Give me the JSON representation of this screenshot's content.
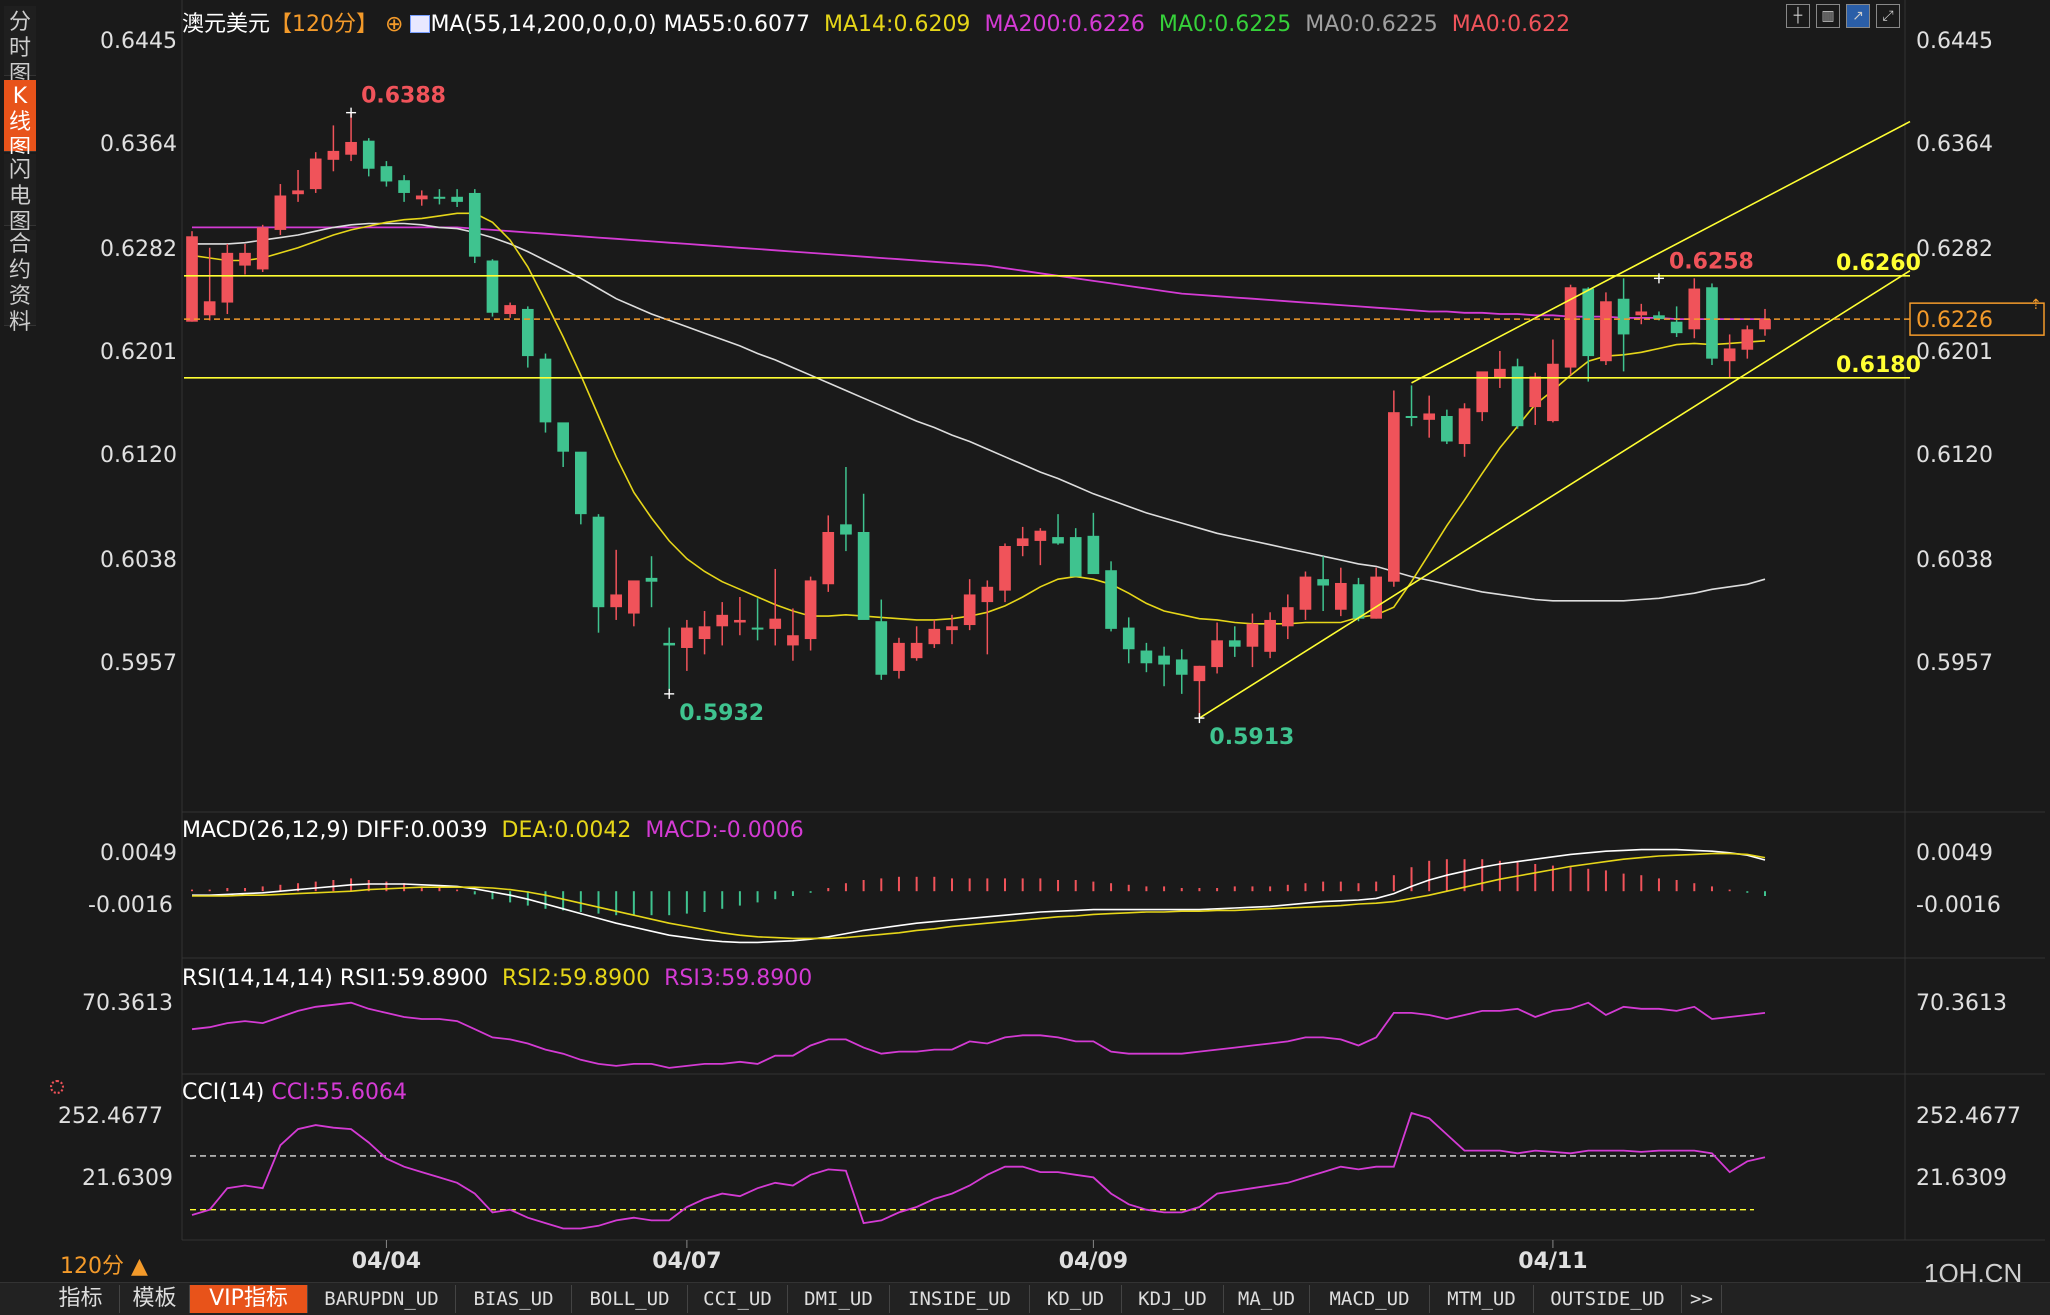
{
  "side_tabs": [
    "分\n时\n图",
    "K\n线\n图",
    "闪\n电\n图",
    "合\n约\n资\n料"
  ],
  "header": {
    "symbol": "澳元美元",
    "period": "【120分】",
    "ma_params": "MA(55,14,200,0,0,0)",
    "ma55": "MA55:0.6077",
    "ma14": "MA14:0.6209",
    "ma200": "MA200:0.6226",
    "ma0_a": "MA0:0.6225",
    "ma0_b": "MA0:0.6225",
    "ma0_c": "MA0:0.622"
  },
  "macd_header": {
    "name": "MACD(26,12,9)",
    "diff": "DIFF:0.0039",
    "dea": "DEA:0.0042",
    "macd": "MACD:-0.0006"
  },
  "rsi_header": {
    "name": "RSI(14,14,14)",
    "rsi1": "RSI1:59.8900",
    "rsi2": "RSI2:59.8900",
    "rsi3": "RSI3:59.8900"
  },
  "cci_header": {
    "name": "CCI(14)",
    "cci": "CCI:55.6064"
  },
  "period_button": "120分",
  "watermark": "1QH.CN",
  "bottom_tabs": [
    "指标",
    "模板",
    "VIP指标",
    "BARUPDN_UD",
    "BIAS_UD",
    "BOLL_UD",
    "CCI_UD",
    "DMI_UD",
    "INSIDE_UD",
    "KD_UD",
    "KDJ_UD",
    "MA_UD",
    "MACD_UD",
    "MTM_UD",
    "OUTSIDE_UD",
    ">>"
  ],
  "colors": {
    "up": "#f0535a",
    "down": "#3fc38f",
    "ma14": "#e6d619",
    "ma55": "#dddddd",
    "ma200": "#d43bd4",
    "trend": "#ffff33",
    "price_tag": "#f39a2a"
  },
  "chart_data": {
    "type": "candlestick",
    "y_ticks": [
      "0.6445",
      "0.6364",
      "0.6282",
      "0.6201",
      "0.6120",
      "0.6038",
      "0.5957"
    ],
    "y_range": [
      0.589,
      0.6465
    ],
    "x_labels": [
      "04/04",
      "04/07",
      "04/09",
      "04/11"
    ],
    "x_label_index": [
      11,
      28,
      51,
      77
    ],
    "ohlc": [
      [
        0.6224,
        0.6295,
        0.6224,
        0.6291
      ],
      [
        0.6229,
        0.6282,
        0.6225,
        0.624
      ],
      [
        0.6239,
        0.6285,
        0.623,
        0.6278
      ],
      [
        0.6268,
        0.6285,
        0.6261,
        0.6278
      ],
      [
        0.6265,
        0.63,
        0.6263,
        0.6298
      ],
      [
        0.6296,
        0.6332,
        0.6292,
        0.6323
      ],
      [
        0.6324,
        0.6343,
        0.6318,
        0.6327
      ],
      [
        0.6328,
        0.6357,
        0.6325,
        0.6352
      ],
      [
        0.6351,
        0.6378,
        0.6342,
        0.6358
      ],
      [
        0.6355,
        0.6388,
        0.635,
        0.6365
      ],
      [
        0.6366,
        0.6368,
        0.6338,
        0.6344
      ],
      [
        0.6346,
        0.635,
        0.633,
        0.6334
      ],
      [
        0.6335,
        0.6339,
        0.6318,
        0.6325
      ],
      [
        0.632,
        0.6327,
        0.6315,
        0.6323
      ],
      [
        0.6322,
        0.6328,
        0.6316,
        0.6321
      ],
      [
        0.6322,
        0.6328,
        0.6314,
        0.6318
      ],
      [
        0.6325,
        0.6328,
        0.627,
        0.6275
      ],
      [
        0.6272,
        0.6273,
        0.6228,
        0.6231
      ],
      [
        0.623,
        0.6239,
        0.6227,
        0.6237
      ],
      [
        0.6234,
        0.6236,
        0.6188,
        0.6197
      ],
      [
        0.6195,
        0.6199,
        0.6137,
        0.6145
      ],
      [
        0.6145,
        0.6144,
        0.611,
        0.6122
      ],
      [
        0.6122,
        0.6118,
        0.6065,
        0.6073
      ],
      [
        0.6071,
        0.6073,
        0.598,
        0.6
      ],
      [
        0.6,
        0.6045,
        0.599,
        0.601
      ],
      [
        0.5995,
        0.6018,
        0.5985,
        0.6021
      ],
      [
        0.6023,
        0.604,
        0.6,
        0.602
      ],
      [
        0.5972,
        0.5984,
        0.5934,
        0.597
      ],
      [
        0.5968,
        0.599,
        0.595,
        0.5984
      ],
      [
        0.5975,
        0.5997,
        0.5963,
        0.5985
      ],
      [
        0.5985,
        0.6004,
        0.597,
        0.5994
      ],
      [
        0.5988,
        0.6008,
        0.5978,
        0.599
      ],
      [
        0.5984,
        0.6007,
        0.5974,
        0.5983
      ],
      [
        0.5983,
        0.603,
        0.597,
        0.5991
      ],
      [
        0.597,
        0.5999,
        0.5958,
        0.5978
      ],
      [
        0.5975,
        0.6024,
        0.5966,
        0.6021
      ],
      [
        0.6018,
        0.6072,
        0.6012,
        0.6059
      ],
      [
        0.6065,
        0.611,
        0.6044,
        0.6057
      ],
      [
        0.6059,
        0.6089,
        0.604,
        0.599
      ],
      [
        0.5989,
        0.6006,
        0.5943,
        0.5947
      ],
      [
        0.595,
        0.5976,
        0.5944,
        0.5972
      ],
      [
        0.596,
        0.5985,
        0.5958,
        0.5972
      ],
      [
        0.5971,
        0.599,
        0.5968,
        0.5983
      ],
      [
        0.5982,
        0.5994,
        0.5971,
        0.5985
      ],
      [
        0.5986,
        0.6022,
        0.5982,
        0.601
      ],
      [
        0.6004,
        0.6021,
        0.5963,
        0.6016
      ],
      [
        0.6013,
        0.605,
        0.6004,
        0.6048
      ],
      [
        0.6048,
        0.6063,
        0.604,
        0.6054
      ],
      [
        0.6052,
        0.6062,
        0.6033,
        0.606
      ],
      [
        0.6055,
        0.6073,
        0.6049,
        0.605
      ],
      [
        0.6055,
        0.6062,
        0.6052,
        0.6024
      ],
      [
        0.6056,
        0.6074,
        0.6046,
        0.6026
      ],
      [
        0.6029,
        0.6036,
        0.5981,
        0.5983
      ],
      [
        0.5984,
        0.5992,
        0.5956,
        0.5967
      ],
      [
        0.5966,
        0.5972,
        0.5949,
        0.5956
      ],
      [
        0.5962,
        0.5969,
        0.5938,
        0.5955
      ],
      [
        0.5959,
        0.5967,
        0.5932,
        0.5947
      ],
      [
        0.5942,
        0.5954,
        0.5913,
        0.5954
      ],
      [
        0.5953,
        0.5988,
        0.5948,
        0.5974
      ],
      [
        0.5974,
        0.5985,
        0.5961,
        0.5969
      ],
      [
        0.5969,
        0.5995,
        0.5953,
        0.5987
      ],
      [
        0.5965,
        0.5996,
        0.596,
        0.599
      ],
      [
        0.5985,
        0.601,
        0.5975,
        0.6
      ],
      [
        0.5998,
        0.6028,
        0.599,
        0.6024
      ],
      [
        0.6022,
        0.604,
        0.5997,
        0.6017
      ],
      [
        0.5998,
        0.6031,
        0.5993,
        0.6019
      ],
      [
        0.6018,
        0.6023,
        0.5989,
        0.5991
      ],
      [
        0.5991,
        0.6031,
        0.5991,
        0.6024
      ],
      [
        0.602,
        0.617,
        0.6016,
        0.6153
      ],
      [
        0.615,
        0.6174,
        0.6142,
        0.6149
      ],
      [
        0.6147,
        0.6166,
        0.6133,
        0.6152
      ],
      [
        0.615,
        0.6155,
        0.6128,
        0.613
      ],
      [
        0.6128,
        0.616,
        0.6118,
        0.6156
      ],
      [
        0.6153,
        0.6184,
        0.6146,
        0.6185
      ],
      [
        0.618,
        0.6201,
        0.6172,
        0.6187
      ],
      [
        0.6189,
        0.6195,
        0.614,
        0.6142
      ],
      [
        0.6157,
        0.6184,
        0.6143,
        0.6181
      ],
      [
        0.6146,
        0.621,
        0.6145,
        0.6191
      ],
      [
        0.6188,
        0.6253,
        0.6182,
        0.6251
      ],
      [
        0.625,
        0.6251,
        0.6177,
        0.6197
      ],
      [
        0.6193,
        0.6247,
        0.619,
        0.624
      ],
      [
        0.6242,
        0.6258,
        0.6185,
        0.6214
      ],
      [
        0.6229,
        0.6238,
        0.6222,
        0.6232
      ],
      [
        0.6229,
        0.6232,
        0.6225,
        0.6226
      ],
      [
        0.6224,
        0.6236,
        0.6212,
        0.6215
      ],
      [
        0.6218,
        0.6258,
        0.6211,
        0.625
      ],
      [
        0.6251,
        0.6254,
        0.619,
        0.6195
      ],
      [
        0.6193,
        0.6214,
        0.618,
        0.6203
      ],
      [
        0.6202,
        0.6221,
        0.6195,
        0.6218
      ],
      [
        0.6218,
        0.6234,
        0.6213,
        0.6226
      ]
    ],
    "ma55": [
      0.6285,
      0.6285,
      0.6285,
      0.6286,
      0.6288,
      0.629,
      0.6292,
      0.6295,
      0.6298,
      0.63,
      0.6301,
      0.6301,
      0.6301,
      0.63,
      0.6298,
      0.6297,
      0.6294,
      0.629,
      0.6285,
      0.6279,
      0.6272,
      0.6265,
      0.6258,
      0.625,
      0.6242,
      0.6236,
      0.623,
      0.6225,
      0.622,
      0.6215,
      0.621,
      0.6205,
      0.6199,
      0.6194,
      0.6188,
      0.6182,
      0.6176,
      0.617,
      0.6164,
      0.6158,
      0.6152,
      0.6146,
      0.6141,
      0.6135,
      0.613,
      0.6124,
      0.6118,
      0.6112,
      0.6106,
      0.6101,
      0.6095,
      0.6089,
      0.6084,
      0.6079,
      0.6074,
      0.607,
      0.6066,
      0.6062,
      0.6058,
      0.6055,
      0.6052,
      0.6049,
      0.6046,
      0.6043,
      0.604,
      0.6037,
      0.6034,
      0.6032,
      0.6028,
      0.6024,
      0.6021,
      0.6018,
      0.6015,
      0.6012,
      0.601,
      0.6008,
      0.6006,
      0.6005,
      0.6005,
      0.6005,
      0.6005,
      0.6005,
      0.6006,
      0.6007,
      0.6009,
      0.6011,
      0.6014,
      0.6016,
      0.6018,
      0.6022
    ],
    "ma14": [
      0.6276,
      0.6274,
      0.6272,
      0.6272,
      0.6274,
      0.6278,
      0.6282,
      0.6287,
      0.6292,
      0.6296,
      0.6299,
      0.6302,
      0.6304,
      0.6305,
      0.6307,
      0.6309,
      0.6309,
      0.6302,
      0.6288,
      0.6267,
      0.624,
      0.6212,
      0.6182,
      0.615,
      0.6118,
      0.609,
      0.607,
      0.6052,
      0.6038,
      0.6028,
      0.602,
      0.6014,
      0.6008,
      0.6002,
      0.5997,
      0.5993,
      0.5993,
      0.5994,
      0.5993,
      0.5992,
      0.5991,
      0.599,
      0.599,
      0.5991,
      0.5993,
      0.5996,
      0.6001,
      0.6008,
      0.6016,
      0.6022,
      0.6024,
      0.6022,
      0.6018,
      0.6011,
      0.6003,
      0.5997,
      0.5994,
      0.5991,
      0.599,
      0.5988,
      0.5987,
      0.5987,
      0.5987,
      0.5988,
      0.5988,
      0.5988,
      0.5992,
      0.5994,
      0.6,
      0.602,
      0.6042,
      0.6064,
      0.6084,
      0.6105,
      0.6125,
      0.6142,
      0.6159,
      0.617,
      0.6182,
      0.6193,
      0.6197,
      0.6198,
      0.62,
      0.6203,
      0.6206,
      0.6207,
      0.6206,
      0.6207,
      0.6208,
      0.6209
    ],
    "ma200": [
      0.6298,
      0.6298,
      0.6298,
      0.6298,
      0.6298,
      0.6298,
      0.6298,
      0.6298,
      0.6298,
      0.6298,
      0.6298,
      0.6298,
      0.6298,
      0.6298,
      0.6298,
      0.6298,
      0.6297,
      0.6296,
      0.6295,
      0.6294,
      0.6293,
      0.6292,
      0.6291,
      0.629,
      0.6289,
      0.6288,
      0.6287,
      0.6286,
      0.6285,
      0.6284,
      0.6283,
      0.6282,
      0.6281,
      0.628,
      0.6279,
      0.6278,
      0.6277,
      0.6276,
      0.6275,
      0.6274,
      0.6273,
      0.6272,
      0.6271,
      0.627,
      0.6269,
      0.6268,
      0.6266,
      0.6264,
      0.6262,
      0.626,
      0.6258,
      0.6256,
      0.6254,
      0.6252,
      0.625,
      0.6248,
      0.6246,
      0.6245,
      0.6244,
      0.6243,
      0.6242,
      0.6241,
      0.624,
      0.6239,
      0.6238,
      0.6237,
      0.6236,
      0.6235,
      0.6234,
      0.6233,
      0.6232,
      0.6232,
      0.6231,
      0.6231,
      0.623,
      0.623,
      0.6229,
      0.6229,
      0.6228,
      0.6228,
      0.6228,
      0.6227,
      0.6227,
      0.6227,
      0.6226,
      0.6226,
      0.6226,
      0.6226,
      0.6226,
      0.6226
    ],
    "annotations": [
      {
        "label": "0.6388",
        "price": 0.6388,
        "index": 9,
        "color": "#f0535a"
      },
      {
        "label": "0.5932",
        "price": 0.5932,
        "index": 27,
        "color": "#3fc38f"
      },
      {
        "label": "0.5913",
        "price": 0.5913,
        "index": 57,
        "color": "#3fc38f"
      },
      {
        "label": "0.6258",
        "price": 0.6258,
        "index": 83,
        "color": "#f0535a"
      }
    ],
    "horizontal_lines": [
      {
        "price": 0.626,
        "label": "0.6260"
      },
      {
        "price": 0.618,
        "label": "0.6180"
      }
    ],
    "last_price": {
      "price": 0.6226,
      "label": "0.6226"
    },
    "macd": {
      "y_ticks": [
        "0.0049",
        "-0.0016"
      ],
      "diff": [
        -0.0005,
        -0.0005,
        -0.0004,
        -0.0003,
        -0.0002,
        0.0,
        0.0002,
        0.0004,
        0.0006,
        0.0008,
        0.0009,
        0.0009,
        0.0009,
        0.0008,
        0.0007,
        0.0006,
        0.0003,
        -0.0001,
        -0.0005,
        -0.001,
        -0.0016,
        -0.0022,
        -0.0028,
        -0.0034,
        -0.004,
        -0.0045,
        -0.005,
        -0.0055,
        -0.0058,
        -0.0061,
        -0.0063,
        -0.0064,
        -0.0064,
        -0.0063,
        -0.0062,
        -0.006,
        -0.0057,
        -0.0053,
        -0.0049,
        -0.0046,
        -0.0043,
        -0.004,
        -0.0038,
        -0.0036,
        -0.0034,
        -0.0032,
        -0.003,
        -0.0028,
        -0.0026,
        -0.0025,
        -0.0024,
        -0.0023,
        -0.0023,
        -0.0023,
        -0.0023,
        -0.0023,
        -0.0023,
        -0.0023,
        -0.0022,
        -0.0021,
        -0.002,
        -0.0019,
        -0.0017,
        -0.0015,
        -0.0013,
        -0.0012,
        -0.0011,
        -0.0009,
        -0.0003,
        0.0006,
        0.0014,
        0.002,
        0.0025,
        0.003,
        0.0034,
        0.0037,
        0.004,
        0.0043,
        0.0046,
        0.0048,
        0.005,
        0.0051,
        0.0052,
        0.0052,
        0.0052,
        0.0051,
        0.005,
        0.0048,
        0.0045,
        0.0039
      ],
      "dea": [
        -0.0006,
        -0.0006,
        -0.0006,
        -0.0005,
        -0.0005,
        -0.0004,
        -0.0003,
        -0.0002,
        -0.0001,
        0.0,
        0.0002,
        0.0003,
        0.0004,
        0.0005,
        0.0005,
        0.0005,
        0.0005,
        0.0004,
        0.0002,
        -0.0001,
        -0.0005,
        -0.001,
        -0.0015,
        -0.002,
        -0.0025,
        -0.003,
        -0.0035,
        -0.004,
        -0.0044,
        -0.0048,
        -0.0052,
        -0.0055,
        -0.0057,
        -0.0058,
        -0.0059,
        -0.0059,
        -0.0059,
        -0.0058,
        -0.0056,
        -0.0054,
        -0.0052,
        -0.0049,
        -0.0047,
        -0.0044,
        -0.0042,
        -0.004,
        -0.0038,
        -0.0036,
        -0.0034,
        -0.0032,
        -0.0031,
        -0.0029,
        -0.0028,
        -0.0027,
        -0.0026,
        -0.0026,
        -0.0025,
        -0.0025,
        -0.0024,
        -0.0024,
        -0.0023,
        -0.0022,
        -0.0021,
        -0.002,
        -0.0019,
        -0.0018,
        -0.0016,
        -0.0015,
        -0.0013,
        -0.0009,
        -0.0005,
        0.0,
        0.0005,
        0.001,
        0.0015,
        0.0019,
        0.0023,
        0.0027,
        0.0031,
        0.0034,
        0.0037,
        0.004,
        0.0042,
        0.0044,
        0.0045,
        0.0046,
        0.0047,
        0.0047,
        0.0046,
        0.0042
      ]
    },
    "rsi": {
      "y_ticks": [
        "70.3613"
      ],
      "values": [
        57,
        58,
        60,
        61,
        60,
        63,
        66,
        68,
        69,
        70,
        67,
        65,
        63,
        62,
        62,
        61,
        57,
        53,
        52,
        50,
        47,
        45,
        42,
        40,
        39,
        40,
        40,
        38,
        39,
        40,
        40,
        41,
        40,
        44,
        44,
        49,
        52,
        52,
        48,
        45,
        46,
        46,
        47,
        47,
        51,
        50,
        53,
        54,
        54,
        53,
        51,
        51,
        46,
        45,
        45,
        45,
        45,
        46,
        47,
        48,
        49,
        50,
        51,
        53,
        53,
        52,
        49,
        53,
        65,
        65,
        64,
        62,
        64,
        66,
        66,
        67,
        63,
        66,
        67,
        70,
        64,
        68,
        67,
        67,
        66,
        68,
        62,
        63,
        64,
        65
      ]
    },
    "cci": {
      "y_ticks": [
        "252.4677",
        "21.6309"
      ],
      "values": [
        -120,
        -100,
        -20,
        -10,
        -20,
        140,
        200,
        215,
        205,
        200,
        150,
        90,
        60,
        40,
        20,
        0,
        -40,
        -110,
        -100,
        -130,
        -150,
        -170,
        -170,
        -160,
        -140,
        -130,
        -140,
        -140,
        -90,
        -60,
        -40,
        -50,
        -20,
        0,
        -10,
        30,
        50,
        45,
        -150,
        -140,
        -110,
        -90,
        -60,
        -40,
        -10,
        30,
        60,
        60,
        40,
        40,
        30,
        20,
        -40,
        -80,
        -100,
        -110,
        -110,
        -90,
        -40,
        -30,
        -20,
        -10,
        0,
        20,
        40,
        60,
        50,
        60,
        60,
        260,
        240,
        180,
        120,
        120,
        120,
        110,
        120,
        115,
        110,
        120,
        120,
        120,
        115,
        120,
        120,
        120,
        110,
        40,
        80,
        95
      ]
    }
  }
}
